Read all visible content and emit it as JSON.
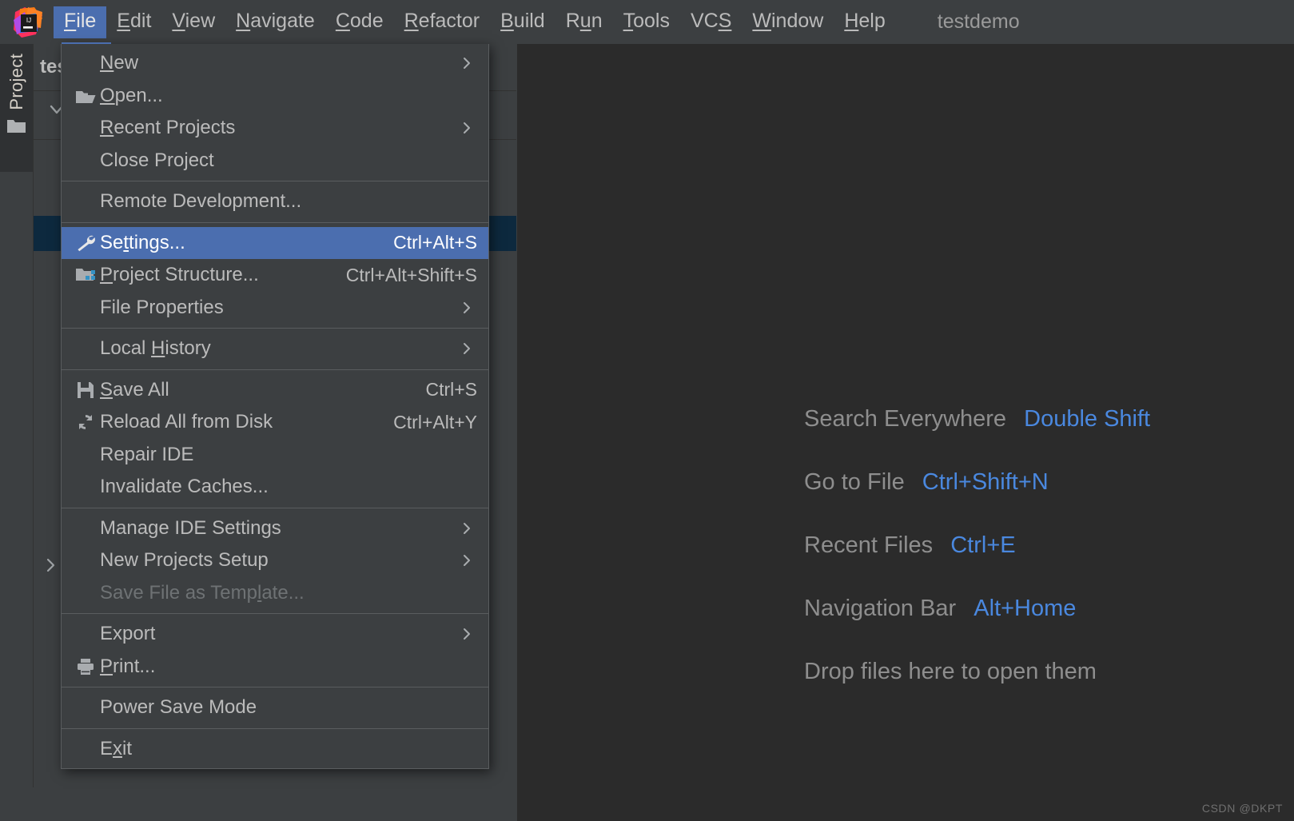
{
  "window": {
    "project_title": "testdemo",
    "watermark": "CSDN @DKPT"
  },
  "menubar": {
    "logo_icon": "intellij-idea-logo",
    "items": [
      {
        "label": "File",
        "mnemonic": "F",
        "active": true
      },
      {
        "label": "Edit",
        "mnemonic": "E",
        "active": false
      },
      {
        "label": "View",
        "mnemonic": "V",
        "active": false
      },
      {
        "label": "Navigate",
        "mnemonic": "N",
        "active": false
      },
      {
        "label": "Code",
        "mnemonic": "C",
        "active": false
      },
      {
        "label": "Refactor",
        "mnemonic": "R",
        "active": false
      },
      {
        "label": "Build",
        "mnemonic": "B",
        "active": false
      },
      {
        "label": "Run",
        "mnemonic": "u",
        "active": false
      },
      {
        "label": "Tools",
        "mnemonic": "T",
        "active": false
      },
      {
        "label": "VCS",
        "mnemonic": "S",
        "active": false
      },
      {
        "label": "Window",
        "mnemonic": "W",
        "active": false
      },
      {
        "label": "Help",
        "mnemonic": "H",
        "active": false
      }
    ]
  },
  "sidebar": {
    "stripe_label": "Project",
    "stripe_icon": "folder-icon",
    "toolwindow_title": "testdemo"
  },
  "file_menu": {
    "groups": [
      {
        "items": [
          {
            "label": "New",
            "mnemonic": "N",
            "icon": null,
            "shortcut": null,
            "submenu": true,
            "disabled": false,
            "highlight": false
          },
          {
            "label": "Open...",
            "mnemonic": "O",
            "icon": "open-folder-icon",
            "shortcut": null,
            "submenu": false,
            "disabled": false,
            "highlight": false
          },
          {
            "label": "Recent Projects",
            "mnemonic": "R",
            "icon": null,
            "shortcut": null,
            "submenu": true,
            "disabled": false,
            "highlight": false
          },
          {
            "label": "Close Project",
            "mnemonic": null,
            "icon": null,
            "shortcut": null,
            "submenu": false,
            "disabled": false,
            "highlight": false
          }
        ]
      },
      {
        "items": [
          {
            "label": "Remote Development...",
            "mnemonic": null,
            "icon": null,
            "shortcut": null,
            "submenu": false,
            "disabled": false,
            "highlight": false
          }
        ]
      },
      {
        "items": [
          {
            "label": "Settings...",
            "mnemonic": "t",
            "icon": "wrench-icon",
            "shortcut": "Ctrl+Alt+S",
            "submenu": false,
            "disabled": false,
            "highlight": true
          },
          {
            "label": "Project Structure...",
            "mnemonic": "P",
            "icon": "project-structure-icon",
            "shortcut": "Ctrl+Alt+Shift+S",
            "submenu": false,
            "disabled": false,
            "highlight": false
          },
          {
            "label": "File Properties",
            "mnemonic": null,
            "icon": null,
            "shortcut": null,
            "submenu": true,
            "disabled": false,
            "highlight": false
          }
        ]
      },
      {
        "items": [
          {
            "label": "Local History",
            "mnemonic": "H",
            "icon": null,
            "shortcut": null,
            "submenu": true,
            "disabled": false,
            "highlight": false
          }
        ]
      },
      {
        "items": [
          {
            "label": "Save All",
            "mnemonic": "S",
            "icon": "save-icon",
            "shortcut": "Ctrl+S",
            "submenu": false,
            "disabled": false,
            "highlight": false
          },
          {
            "label": "Reload All from Disk",
            "mnemonic": null,
            "icon": "reload-icon",
            "shortcut": "Ctrl+Alt+Y",
            "submenu": false,
            "disabled": false,
            "highlight": false
          },
          {
            "label": "Repair IDE",
            "mnemonic": null,
            "icon": null,
            "shortcut": null,
            "submenu": false,
            "disabled": false,
            "highlight": false
          },
          {
            "label": "Invalidate Caches...",
            "mnemonic": null,
            "icon": null,
            "shortcut": null,
            "submenu": false,
            "disabled": false,
            "highlight": false
          }
        ]
      },
      {
        "items": [
          {
            "label": "Manage IDE Settings",
            "mnemonic": null,
            "icon": null,
            "shortcut": null,
            "submenu": true,
            "disabled": false,
            "highlight": false
          },
          {
            "label": "New Projects Setup",
            "mnemonic": null,
            "icon": null,
            "shortcut": null,
            "submenu": true,
            "disabled": false,
            "highlight": false
          },
          {
            "label": "Save File as Template...",
            "mnemonic": "l",
            "icon": null,
            "shortcut": null,
            "submenu": false,
            "disabled": true,
            "highlight": false
          }
        ]
      },
      {
        "items": [
          {
            "label": "Export",
            "mnemonic": null,
            "icon": null,
            "shortcut": null,
            "submenu": true,
            "disabled": false,
            "highlight": false
          },
          {
            "label": "Print...",
            "mnemonic": "P",
            "icon": "printer-icon",
            "shortcut": null,
            "submenu": false,
            "disabled": false,
            "highlight": false
          }
        ]
      },
      {
        "items": [
          {
            "label": "Power Save Mode",
            "mnemonic": null,
            "icon": null,
            "shortcut": null,
            "submenu": false,
            "disabled": false,
            "highlight": false
          }
        ]
      },
      {
        "items": [
          {
            "label": "Exit",
            "mnemonic": "x",
            "icon": null,
            "shortcut": null,
            "submenu": false,
            "disabled": false,
            "highlight": false
          }
        ]
      }
    ]
  },
  "editor_hints": [
    {
      "label": "Search Everywhere",
      "key": "Double Shift"
    },
    {
      "label": "Go to File",
      "key": "Ctrl+Shift+N"
    },
    {
      "label": "Recent Files",
      "key": "Ctrl+E"
    },
    {
      "label": "Navigation Bar",
      "key": "Alt+Home"
    },
    {
      "label": "Drop files here to open them",
      "key": ""
    }
  ],
  "colors": {
    "menu_bg": "#3c3f41",
    "editor_bg": "#2b2b2b",
    "accent": "#4b6eaf",
    "key_blue": "#4a88df",
    "text": "#bbbbbb",
    "selection_tree": "#0d293e"
  }
}
